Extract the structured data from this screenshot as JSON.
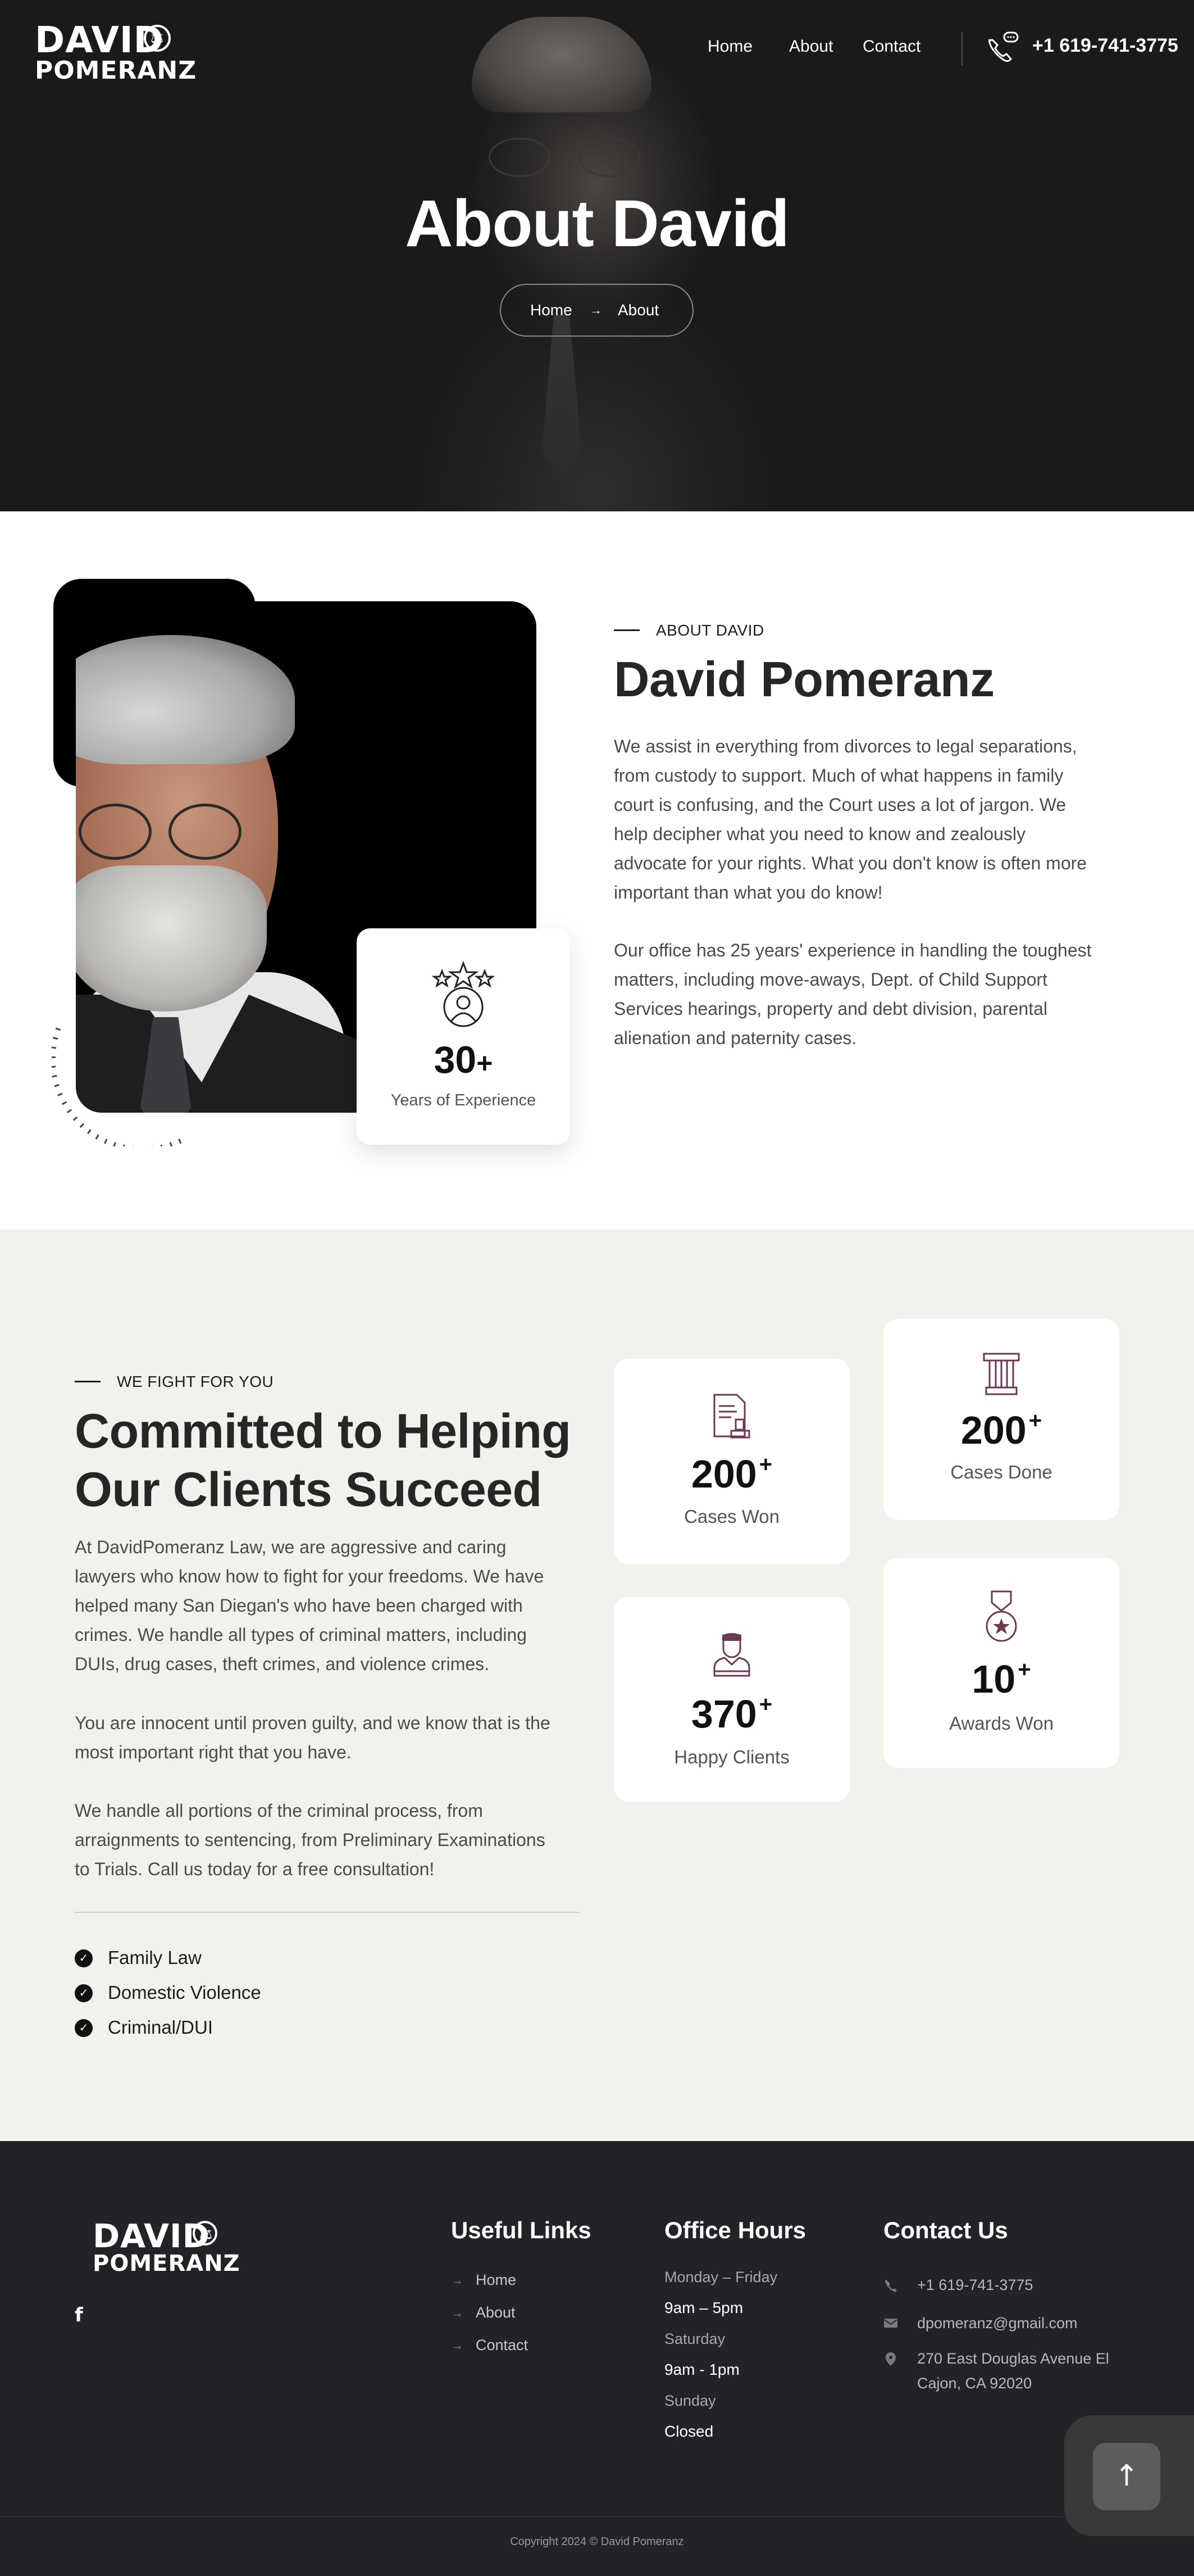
{
  "brand": {
    "logo_line1": "DAVID",
    "logo_line2": "POMERANZ"
  },
  "nav": {
    "home": "Home",
    "about": "About",
    "contact": "Contact",
    "phone": "+1 619-741-3775"
  },
  "hero": {
    "title": "About David",
    "crumb_home": "Home",
    "crumb_arrow": "→",
    "crumb_current": "About"
  },
  "about": {
    "eyebrow": "ABOUT DAVID",
    "heading": "David Pomeranz",
    "para1_lines": [
      "We assist in everything from divorces to legal separations,",
      "from custody to support. Much of what happens in family",
      "court is confusing, and the Court uses a lot of jargon. We",
      "help decipher what you need to know and zealously",
      "advocate for your rights. What you don't know is often more",
      "important than what you do know!"
    ],
    "para2_lines": [
      "Our office has 25 years' experience in handling the toughest",
      "matters, including move-aways, Dept. of Child Support",
      "Services hearings, property and debt division, parental",
      "alienation and paternity cases."
    ],
    "experience_number": "30",
    "experience_plus": "+",
    "experience_label": "Years of Experience"
  },
  "fight": {
    "eyebrow": "WE FIGHT FOR YOU",
    "heading_line1": "Committed to Helping",
    "heading_line2": "Our Clients Succeed",
    "para1_lines": [
      "At DavidPomeranz Law, we are aggressive and caring",
      "lawyers who know how to fight for your freedoms. We have",
      "helped many San Diegan's who have been charged with",
      "crimes. We handle all types of criminal matters, including",
      "DUIs, drug cases, theft crimes, and violence crimes."
    ],
    "para2_lines": [
      "You are innocent until proven guilty, and we know that is the",
      "most important right that you have."
    ],
    "para3_lines": [
      "We handle all portions of the criminal process, from",
      "arraignments to sentencing, from Preliminary Examinations",
      "to Trials. Call us today for a free consultation!"
    ],
    "practice_areas": [
      "Family Law",
      "Domestic Violence",
      "Criminal/DUI"
    ],
    "stats": [
      {
        "number": "200",
        "plus": "+",
        "label": "Cases Won",
        "icon": "document-gavel-icon"
      },
      {
        "number": "200",
        "plus": "+",
        "label": "Cases Done",
        "icon": "pillar-icon"
      },
      {
        "number": "370",
        "plus": "+",
        "label": "Happy Clients",
        "icon": "client-icon"
      },
      {
        "number": "10",
        "plus": "+",
        "label": "Awards Won",
        "icon": "medal-icon"
      }
    ]
  },
  "footer": {
    "useful_links_title": "Useful Links",
    "links": [
      "Home",
      "About",
      "Contact"
    ],
    "hours_title": "Office Hours",
    "hours": [
      {
        "day": "Monday – Friday",
        "time": "9am – 5pm"
      },
      {
        "day": "Saturday",
        "time": "9am - 1pm"
      },
      {
        "day": "Sunday",
        "time": "Closed"
      }
    ],
    "contact_title": "Contact Us",
    "phone": "+1 619-741-3775",
    "email": "dpomeranz@gmail.com",
    "address_line1": "270 East Douglas Avenue El",
    "address_line2": "Cajon, CA 92020",
    "social_facebook": "f",
    "copyright": "Copyright 2024 © David Pomeranz",
    "back_to_top": "↑"
  },
  "colors": {
    "hero_bg": "#1a1a1a",
    "section_bg": "#f3f1ec",
    "footer_bg": "#222326",
    "icon_accent": "#6b3a52"
  }
}
